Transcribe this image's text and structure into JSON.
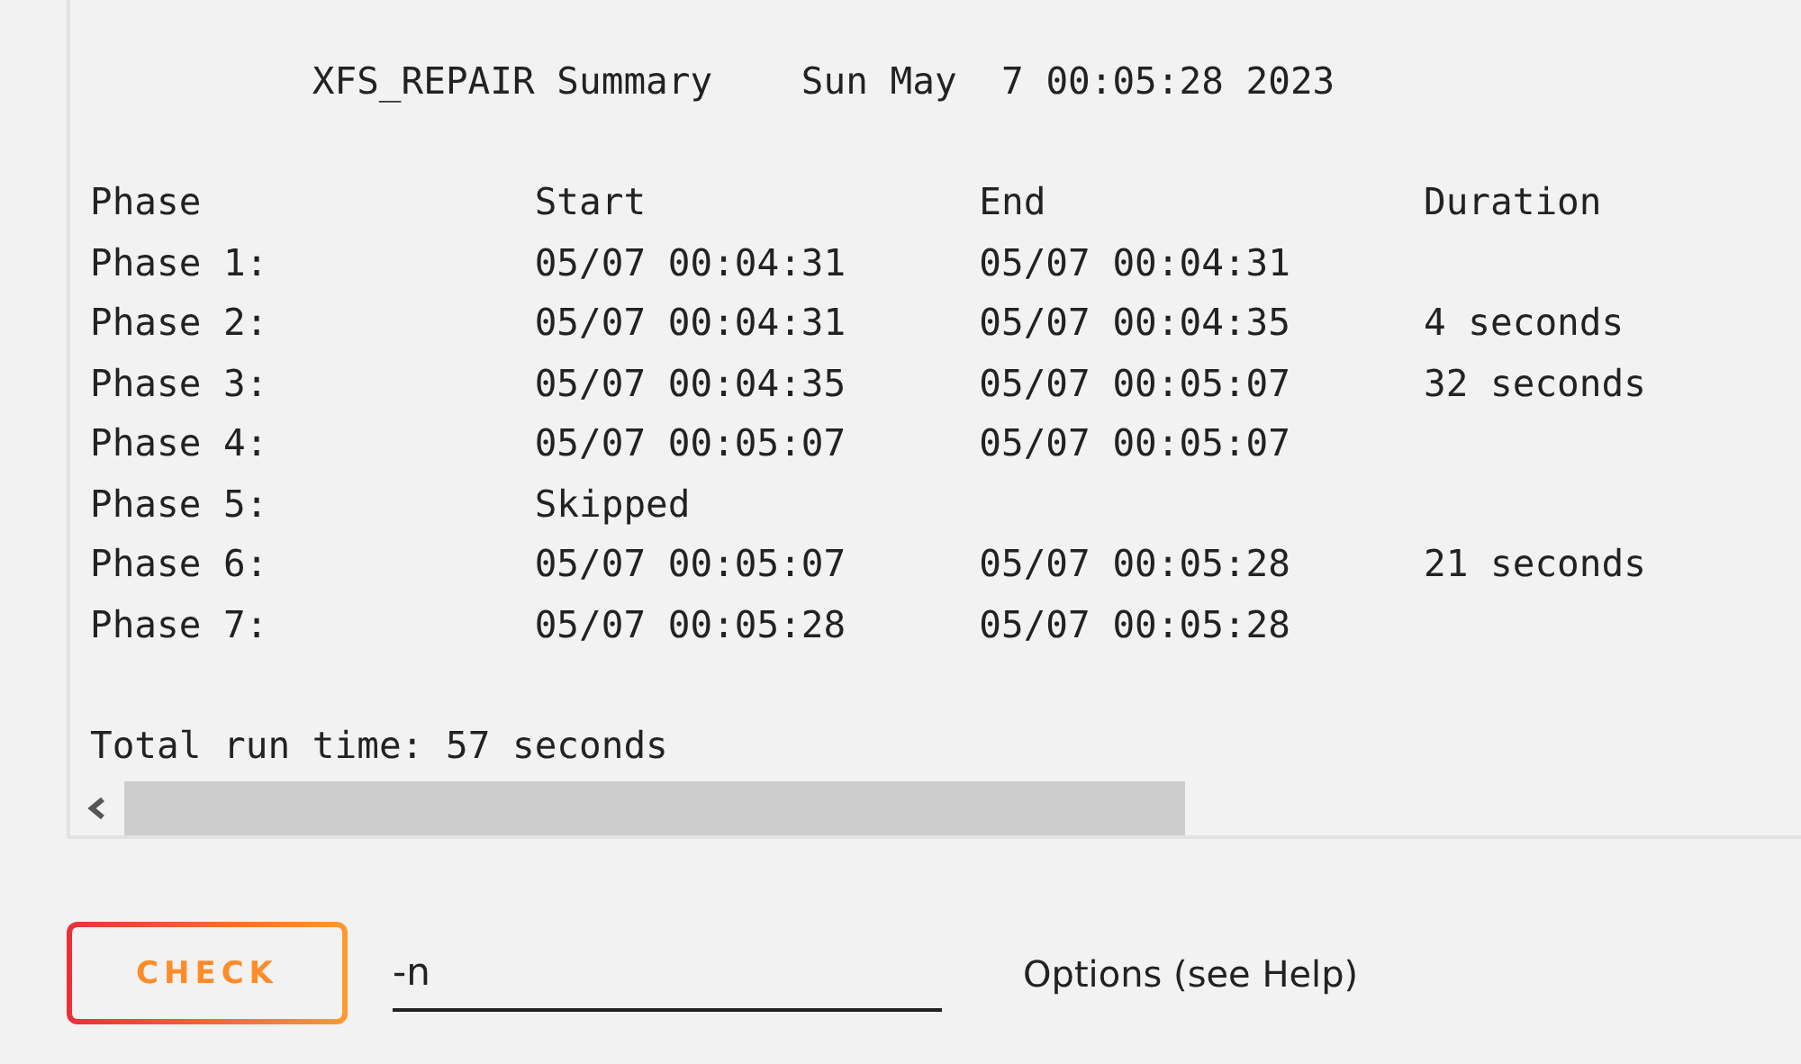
{
  "report": {
    "title": "XFS_REPAIR Summary    Sun May  7 00:05:28 2023",
    "columns": [
      "Phase",
      "Start",
      "End",
      "Duration"
    ],
    "rows": [
      {
        "phase": "Phase 1:",
        "start": "05/07 00:04:31",
        "end": "05/07 00:04:31"
      },
      {
        "phase": "Phase 2:",
        "start": "05/07 00:04:31",
        "end": "05/07 00:04:35",
        "duration": "4 seconds"
      },
      {
        "phase": "Phase 3:",
        "start": "05/07 00:04:35",
        "end": "05/07 00:05:07",
        "duration": "32 seconds"
      },
      {
        "phase": "Phase 4:",
        "start": "05/07 00:05:07",
        "end": "05/07 00:05:07"
      },
      {
        "phase": "Phase 5:",
        "start": "Skipped"
      },
      {
        "phase": "Phase 6:",
        "start": "05/07 00:05:07",
        "end": "05/07 00:05:28",
        "duration": "21 seconds"
      },
      {
        "phase": "Phase 7:",
        "start": "05/07 00:05:28",
        "end": "05/07 00:05:28"
      }
    ],
    "total": "Total run time: 57 seconds"
  },
  "check_button": {
    "label": "CHECK"
  },
  "options_field": {
    "value": "-n"
  },
  "options_label": "Options (see Help)"
}
